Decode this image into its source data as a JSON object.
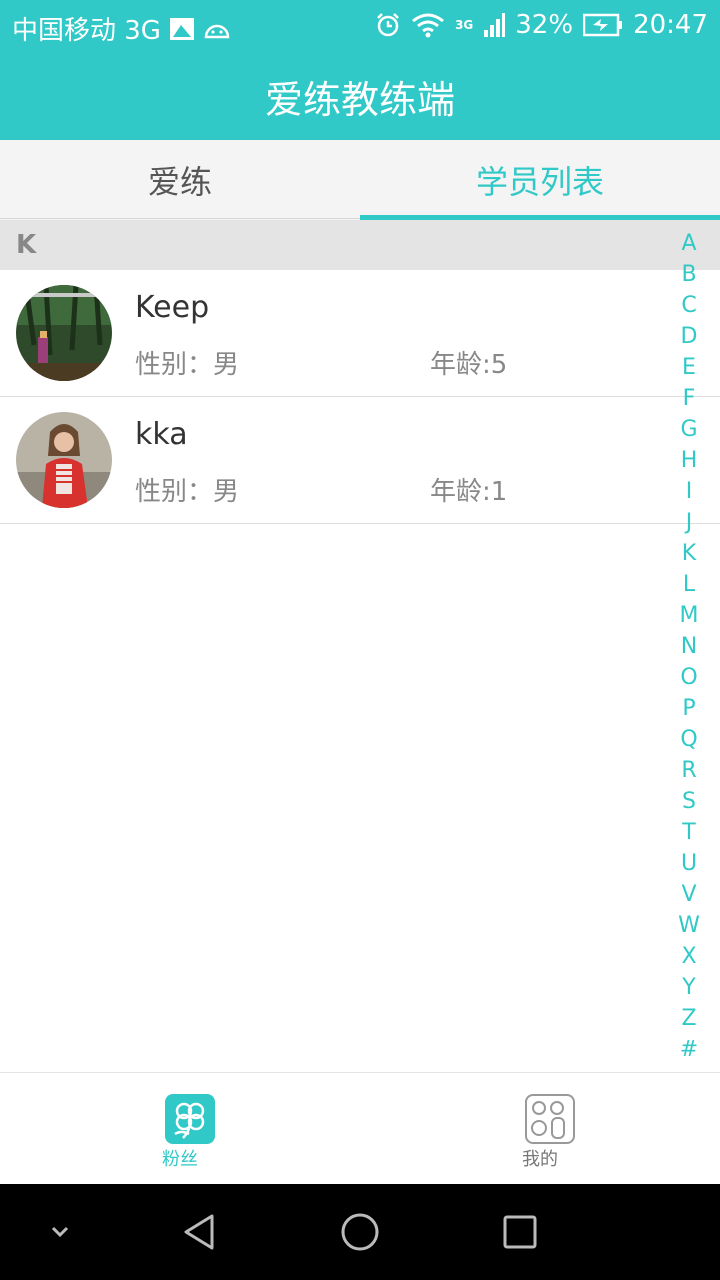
{
  "status_bar": {
    "carrier": "中国移动 3G",
    "battery": "32%",
    "time": "20:47",
    "network_label": "3G"
  },
  "header": {
    "title": "爱练教练端"
  },
  "tabs": [
    {
      "label": "爱练",
      "active": false
    },
    {
      "label": "学员列表",
      "active": true
    }
  ],
  "section": {
    "letter": "K"
  },
  "students": [
    {
      "name": "Keep",
      "gender": "性别：男",
      "age": "年龄:5"
    },
    {
      "name": "kka",
      "gender": "性别：男",
      "age": "年龄:1"
    }
  ],
  "index_letters": [
    "A",
    "B",
    "C",
    "D",
    "E",
    "F",
    "G",
    "H",
    "I",
    "J",
    "K",
    "L",
    "M",
    "N",
    "O",
    "P",
    "Q",
    "R",
    "S",
    "T",
    "U",
    "V",
    "W",
    "X",
    "Y",
    "Z",
    "#"
  ],
  "bottom_nav": [
    {
      "label": "粉丝",
      "icon": "clover-icon",
      "active": true
    },
    {
      "label": "我的",
      "icon": "profile-gear-icon",
      "active": false
    }
  ],
  "colors": {
    "accent": "#30c9c7"
  }
}
